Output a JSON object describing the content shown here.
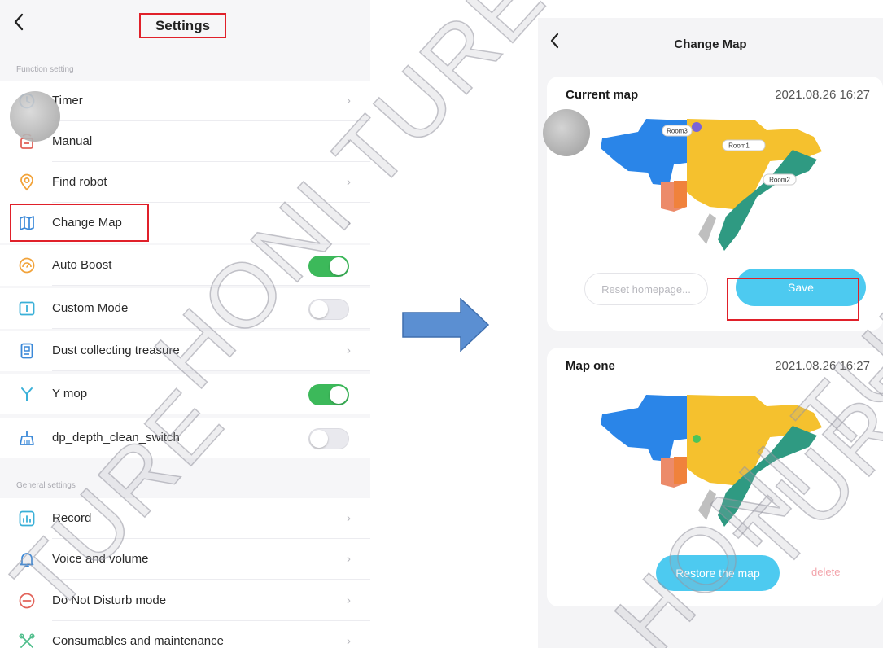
{
  "settings": {
    "back_icon": "chevron-left-icon",
    "title": "Settings",
    "section_function": "Function setting",
    "section_general": "General settings",
    "function_items": [
      {
        "label": "Timer",
        "icon": "clock-icon",
        "type": "chevron"
      },
      {
        "label": "Manual",
        "icon": "remote-control-icon",
        "type": "chevron"
      },
      {
        "label": "Find robot",
        "icon": "location-pin-icon",
        "type": "chevron"
      },
      {
        "label": "Change Map",
        "icon": "map-icon",
        "type": "chevron"
      },
      {
        "label": "Auto Boost",
        "icon": "boost-icon",
        "type": "toggle",
        "on": true
      },
      {
        "label": "Custom Mode",
        "icon": "custom-mode-icon",
        "type": "toggle",
        "on": false
      },
      {
        "label": "Dust collecting treasure",
        "icon": "dust-station-icon",
        "type": "chevron"
      },
      {
        "label": "Y mop",
        "icon": "y-mop-icon",
        "type": "toggle",
        "on": true
      },
      {
        "label": "dp_depth_clean_switch",
        "icon": "broom-icon",
        "type": "toggle",
        "on": false
      }
    ],
    "general_items": [
      {
        "label": "Record",
        "icon": "record-chart-icon"
      },
      {
        "label": "Voice and volume",
        "icon": "bell-icon"
      },
      {
        "label": "Do Not Disturb mode",
        "icon": "do-not-disturb-icon"
      },
      {
        "label": "Consumables and maintenance",
        "icon": "tools-icon"
      }
    ],
    "chevron": "›"
  },
  "change_map": {
    "back": "‹",
    "title": "Change Map",
    "current": {
      "name": "Current map",
      "time": "2021.08.26 16:27",
      "rooms": [
        "Room3",
        "Room1",
        "Room2"
      ],
      "reset_label": "Reset homepage...",
      "save_label": "Save"
    },
    "saved": {
      "name": "Map one",
      "time": "2021.08.26 16:27",
      "restore_label": "Restore the map",
      "delete_label": "delete"
    }
  },
  "watermark": {
    "text_1": "HONI TURE",
    "text_2": "HONI TURE",
    "text_3": "TURE",
    "text_4": "TURE"
  },
  "colors": {
    "accent_red": "#e0202a",
    "toggle_on": "#3cb95a",
    "button_blue": "#4dcaf0",
    "arrow_blue": "#5b8fd2",
    "map_blue": "#2a85e8",
    "map_yellow": "#f5c12e",
    "map_green": "#2f9a82",
    "map_orange": "#f0823c"
  }
}
